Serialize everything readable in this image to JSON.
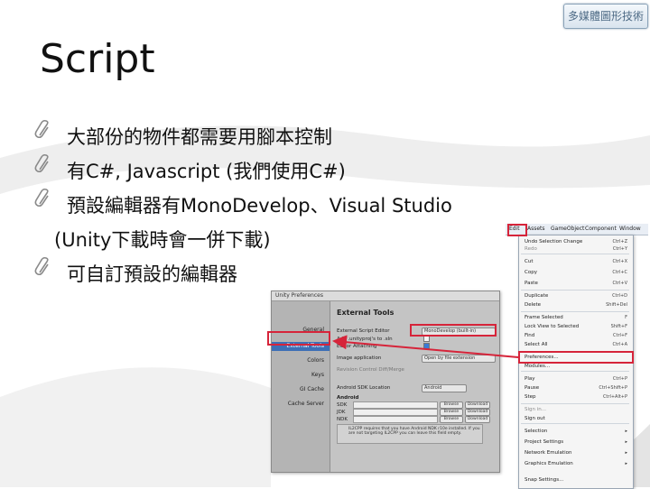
{
  "logo_text": "多媒體圖形技術",
  "slide": {
    "title": "Script",
    "bullets": [
      "大部份的物件都需要用腳本控制",
      "有C#, Javascript (我們使用C#)",
      "預設編輯器有MonoDevelop、Visual Studio",
      "(Unity下載時會一併下載)",
      "可自訂預設的編輯器"
    ]
  },
  "prefs_window": {
    "title": "Unity Preferences",
    "sidebar": [
      "General",
      "External Tools",
      "Colors",
      "Keys",
      "GI Cache",
      "Cache Server"
    ],
    "heading": "External Tools",
    "rows": {
      "script_editor": "External Script Editor",
      "editor_value": "MonoDevelop (built-in)",
      "add_unityscript": "Add .unityproj's to .sln",
      "editor_attaching": "Editor Attaching",
      "image_app": "Image application",
      "image_value": "Open by file extension",
      "revision": "Revision Control Diff/Merge",
      "android_sdk": "Android SDK Location",
      "android_sdk_value": "Android",
      "android": "Android",
      "sdk": "SDK",
      "jdk": "JDK",
      "ndk": "NDK",
      "browse": "Browse",
      "download": "Download",
      "note": "IL2CPP requires that you have Android NDK r10e installed. If you are not targeting IL2CPP you can leave this field empty."
    }
  },
  "menubar": [
    "Edit",
    "Assets",
    "GameObject",
    "Component",
    "Window"
  ],
  "edit_menu": [
    {
      "label": "Undo Selection Change",
      "shortcut": "Ctrl+Z"
    },
    {
      "label": "Redo",
      "shortcut": "Ctrl+Y",
      "gray": true
    },
    {
      "label": "Cut",
      "shortcut": "Ctrl+X"
    },
    {
      "label": "Copy",
      "shortcut": "Ctrl+C"
    },
    {
      "label": "Paste",
      "shortcut": "Ctrl+V"
    },
    {
      "label": "Duplicate",
      "shortcut": "Ctrl+D"
    },
    {
      "label": "Delete",
      "shortcut": "Shift+Del"
    },
    {
      "label": "Frame Selected",
      "shortcut": "F"
    },
    {
      "label": "Lock View to Selected",
      "shortcut": "Shift+F"
    },
    {
      "label": "Find",
      "shortcut": "Ctrl+F"
    },
    {
      "label": "Select All",
      "shortcut": "Ctrl+A"
    },
    {
      "label": "Preferences...",
      "shortcut": ""
    },
    {
      "label": "Modules...",
      "shortcut": ""
    },
    {
      "label": "Play",
      "shortcut": "Ctrl+P"
    },
    {
      "label": "Pause",
      "shortcut": "Ctrl+Shift+P"
    },
    {
      "label": "Step",
      "shortcut": "Ctrl+Alt+P"
    },
    {
      "label": "Sign in...",
      "shortcut": "",
      "gray": true
    },
    {
      "label": "Sign out",
      "shortcut": ""
    },
    {
      "label": "Selection",
      "shortcut": ""
    },
    {
      "label": "Project Settings",
      "shortcut": ""
    },
    {
      "label": "Network Emulation",
      "shortcut": ""
    },
    {
      "label": "Graphics Emulation",
      "shortcut": ""
    },
    {
      "label": "Snap Settings...",
      "shortcut": ""
    }
  ],
  "highlight_color": "#d6243a"
}
